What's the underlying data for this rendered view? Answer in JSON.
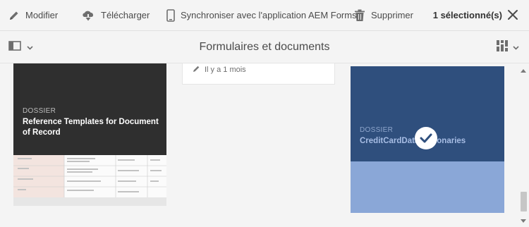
{
  "actionbar": {
    "actions": [
      {
        "label": "Modifier",
        "icon": "pencil-icon"
      },
      {
        "label": "Télécharger",
        "icon": "cloud-download-icon"
      },
      {
        "label": "Synchroniser avec l'application AEM Forms",
        "icon": "mobile-phone-icon"
      },
      {
        "label": "Supprimer",
        "icon": "trash-icon"
      }
    ],
    "selection_count": "1 sélectionné(s)",
    "close_icon": "close-icon"
  },
  "titlebar": {
    "title": "Formulaires et documents",
    "left_icon": "rail-toggle-icon",
    "right_icon": "view-switcher-icon"
  },
  "cards": [
    {
      "type": "DOSSIER",
      "title": "Reference Templates for Document of Record",
      "selected": false
    },
    {
      "modified": "Il y a 1 mois"
    },
    {
      "type": "DOSSIER",
      "title": "CreditCardDataDictionaries",
      "selected": true
    }
  ],
  "colors": {
    "toolbar_bg": "#f4f4f4",
    "card_dark": "#2f2f2f",
    "card_selected_top": "#2f4f7d",
    "card_selected_bottom": "#8aa7d7"
  }
}
